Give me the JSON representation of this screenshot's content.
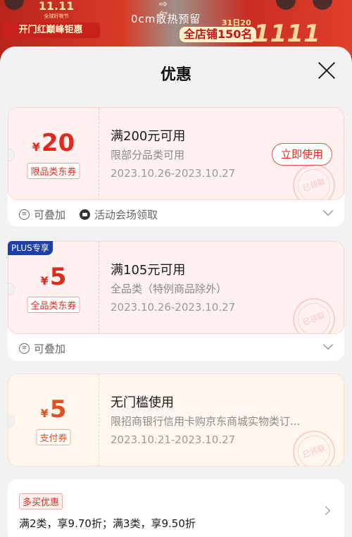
{
  "banner": {
    "logo_main": "11.11",
    "logo_sub": "全球好物节",
    "tag": "开门红巅峰钜惠",
    "center_text": "0cm散热预留",
    "date": "31日20点",
    "rank": "全店铺150名",
    "big": "1111"
  },
  "sheet": {
    "title": "优惠"
  },
  "coupons": [
    {
      "currency": "¥",
      "amount": "20",
      "type": "限品类东券",
      "condition": "满200元可用",
      "scope": "限部分品类可用",
      "dates": "2023.10.26-2023.10.27",
      "button": "立即使用",
      "stamp": "已领取",
      "footer": {
        "stackable": "可叠加",
        "source": "活动会场领取"
      }
    },
    {
      "badge": "PLUS专享",
      "currency": "¥",
      "amount": "5",
      "type": "全品类东券",
      "condition": "满105元可用",
      "scope": "全品类（特例商品除外）",
      "dates": "2023.10.26-2023.10.27",
      "stamp": "已领取",
      "footer": {
        "stackable": "可叠加"
      }
    },
    {
      "currency": "¥",
      "amount": "5",
      "type": "支付券",
      "condition": "无门槛使用",
      "scope": "限招商银行信用卡购京东商城实物类订...",
      "dates": "2023.10.21-2023.10.27",
      "stamp": "已领取"
    }
  ],
  "promo": {
    "tag": "多买优惠",
    "text": "满2类，享9.70折；满3类，享9.50折"
  },
  "colors": {
    "accent": "#e12a1e",
    "plus_badge": "#1f3fa8",
    "sheet_bg": "#f2f2f2"
  },
  "icons": [
    "close-icon",
    "stack-icon",
    "ticket-icon",
    "chevron-down-icon",
    "chevron-right-icon"
  ]
}
